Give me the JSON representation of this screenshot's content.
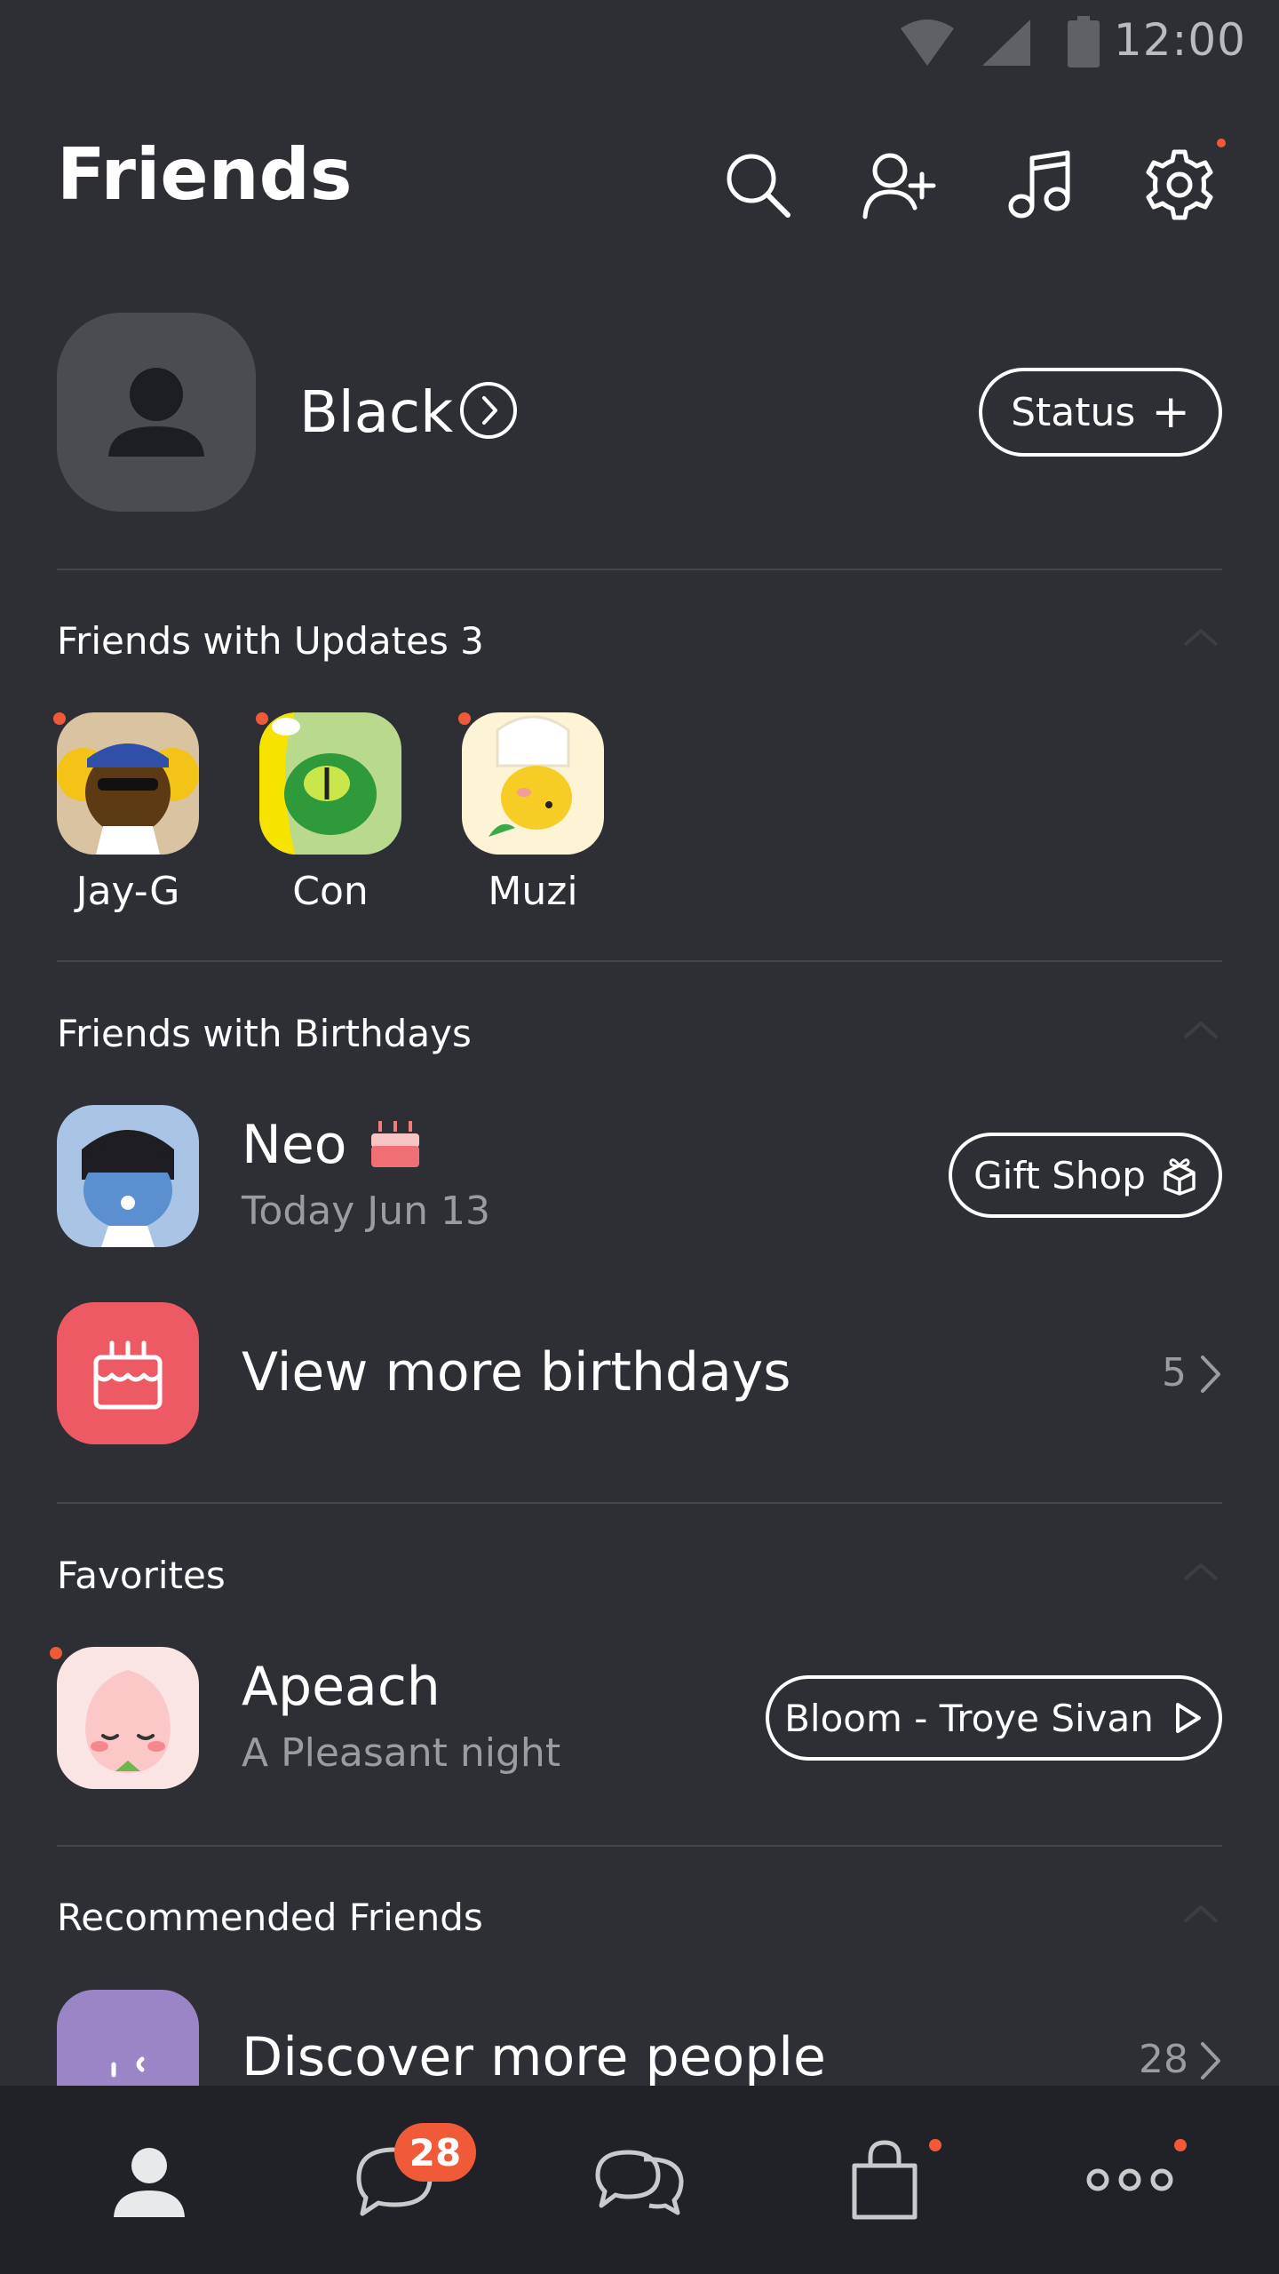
{
  "status_bar": {
    "time": "12:00"
  },
  "header": {
    "title": "Friends"
  },
  "profile": {
    "name": "Black",
    "status_button": "Status"
  },
  "updates": {
    "label": "Friends with Updates 3",
    "friends": [
      {
        "name": "Jay-G"
      },
      {
        "name": "Con"
      },
      {
        "name": "Muzi"
      }
    ]
  },
  "birthdays": {
    "label": "Friends with Birthdays",
    "friend": {
      "name": "Neo",
      "date": "Today Jun 13"
    },
    "gift_button": "Gift Shop",
    "view_more": {
      "label": "View more birthdays",
      "count": "5"
    }
  },
  "favorites": {
    "label": "Favorites",
    "friend": {
      "name": "Apeach",
      "status": "A Pleasant night"
    },
    "music_button": "Bloom - Troye Sivan"
  },
  "recommended": {
    "label": "Recommended Friends",
    "discover": {
      "label": "Discover more people",
      "count": "28"
    }
  },
  "tab_bar": {
    "chats_badge": "28"
  },
  "colors": {
    "background": "#2d2f34",
    "accent_dot": "#f15a38",
    "birthday_icon_bg": "#ee5a63"
  }
}
